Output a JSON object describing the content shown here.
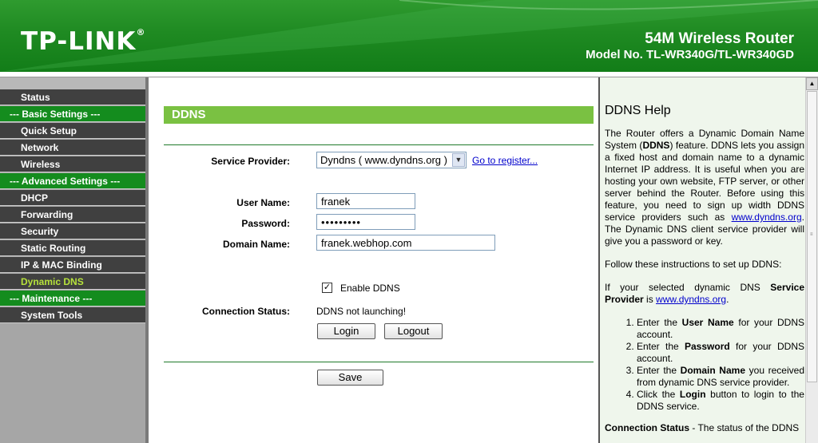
{
  "header": {
    "logo": "TP-LINK",
    "logo_mark": "®",
    "product": "54M Wireless Router",
    "model": "Model No. TL-WR340G/TL-WR340GD"
  },
  "sidebar": {
    "items": [
      {
        "label": "Status",
        "type": "item"
      },
      {
        "label": "--- Basic Settings ---",
        "type": "section"
      },
      {
        "label": "Quick Setup",
        "type": "item"
      },
      {
        "label": "Network",
        "type": "item"
      },
      {
        "label": "Wireless",
        "type": "item"
      },
      {
        "label": "--- Advanced Settings ---",
        "type": "section"
      },
      {
        "label": "DHCP",
        "type": "item"
      },
      {
        "label": "Forwarding",
        "type": "item"
      },
      {
        "label": "Security",
        "type": "item"
      },
      {
        "label": "Static Routing",
        "type": "item"
      },
      {
        "label": "IP & MAC Binding",
        "type": "item"
      },
      {
        "label": "Dynamic DNS",
        "type": "active"
      },
      {
        "label": "--- Maintenance ---",
        "type": "section"
      },
      {
        "label": "System Tools",
        "type": "item"
      }
    ]
  },
  "form": {
    "title": "DDNS",
    "service_provider_label": "Service Provider:",
    "service_provider_value": "Dyndns ( www.dyndns.org )",
    "register_link": "Go to register...",
    "username_label": "User Name:",
    "username_value": "franek",
    "password_label": "Password:",
    "password_value": "•••••••••",
    "domain_label": "Domain Name:",
    "domain_value": "franek.webhop.com",
    "enable_label": "Enable DDNS",
    "enable_checked": "✓",
    "status_label": "Connection Status:",
    "status_value": "DDNS not launching!",
    "login_button": "Login",
    "logout_button": "Logout",
    "save_button": "Save"
  },
  "help": {
    "title": "DDNS Help",
    "p1_a": "The Router offers a Dynamic Domain Name System (",
    "p1_b": "DDNS",
    "p1_c": ") feature. DDNS lets you assign a fixed host and domain name to a dynamic Internet IP address. It is useful when you are hosting your own website, FTP server, or other server behind the Router. Before using this feature, you need to sign up width DDNS service providers such as ",
    "p1_link": "www.dyndns.org",
    "p1_d": ". The Dynamic DNS client service provider will give you a password or key.",
    "p2": "Follow these instructions to set up DDNS:",
    "p3_a": "If your selected dynamic DNS ",
    "p3_b": "Service Provider",
    "p3_c": " is ",
    "p3_link": "www.dyndns.org",
    "p3_d": ".",
    "step1_a": "Enter the ",
    "step1_b": "User Name",
    "step1_c": " for your DDNS account.",
    "step2_a": "Enter the ",
    "step2_b": "Password",
    "step2_c": " for your DDNS account.",
    "step3_a": "Enter the ",
    "step3_b": "Domain Name",
    "step3_c": " you received from dynamic DNS service provider.",
    "step4_a": "Click the ",
    "step4_b": "Login",
    "step4_c": " button to login to the DDNS service.",
    "p4_a": "Connection Status",
    "p4_b": " - The status of the DDNS"
  },
  "icons": {
    "dropdown": "chevron-down-icon",
    "scroll_up": "arrow-up-icon"
  },
  "colors": {
    "brand_green": "#1f8a22",
    "section_bar": "#7ac142",
    "active_item": "#b7e33b"
  }
}
